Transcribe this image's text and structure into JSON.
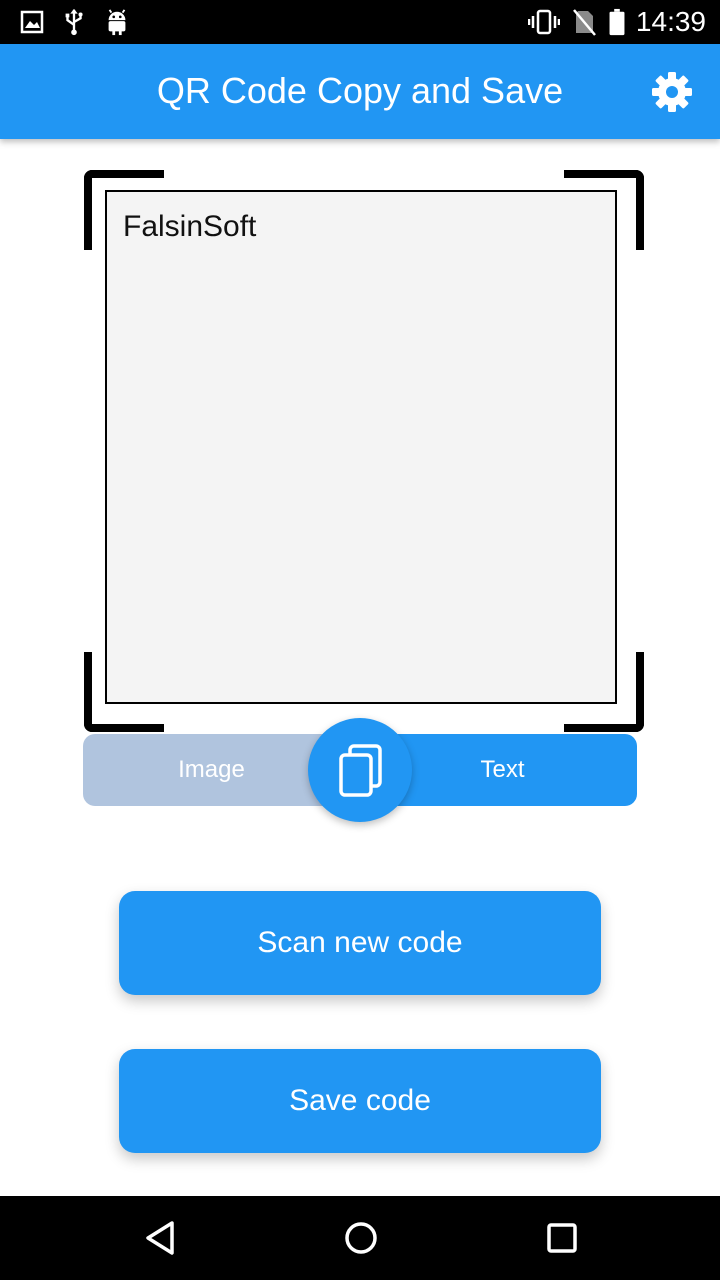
{
  "status_bar": {
    "time": "14:39",
    "left_icons": [
      "gallery-icon",
      "usb-icon",
      "android-icon"
    ],
    "right_icons": [
      "vibrate-icon",
      "no-sim-icon",
      "battery-icon"
    ]
  },
  "app_bar": {
    "title": "QR Code Copy and Save",
    "settings_icon": "gear-icon"
  },
  "scan_result": {
    "text": "FalsinSoft"
  },
  "mode_toggle": {
    "image_label": "Image",
    "text_label": "Text",
    "selected": "Text",
    "copy_icon": "copy-icon"
  },
  "actions": {
    "scan_label": "Scan new code",
    "save_label": "Save code"
  },
  "nav_bar": {
    "icons": [
      "back-icon",
      "home-icon",
      "recents-icon"
    ]
  },
  "colors": {
    "primary": "#2196F3",
    "toggle_inactive": "#B0C4DE",
    "result_background": "#F4F4F4"
  }
}
